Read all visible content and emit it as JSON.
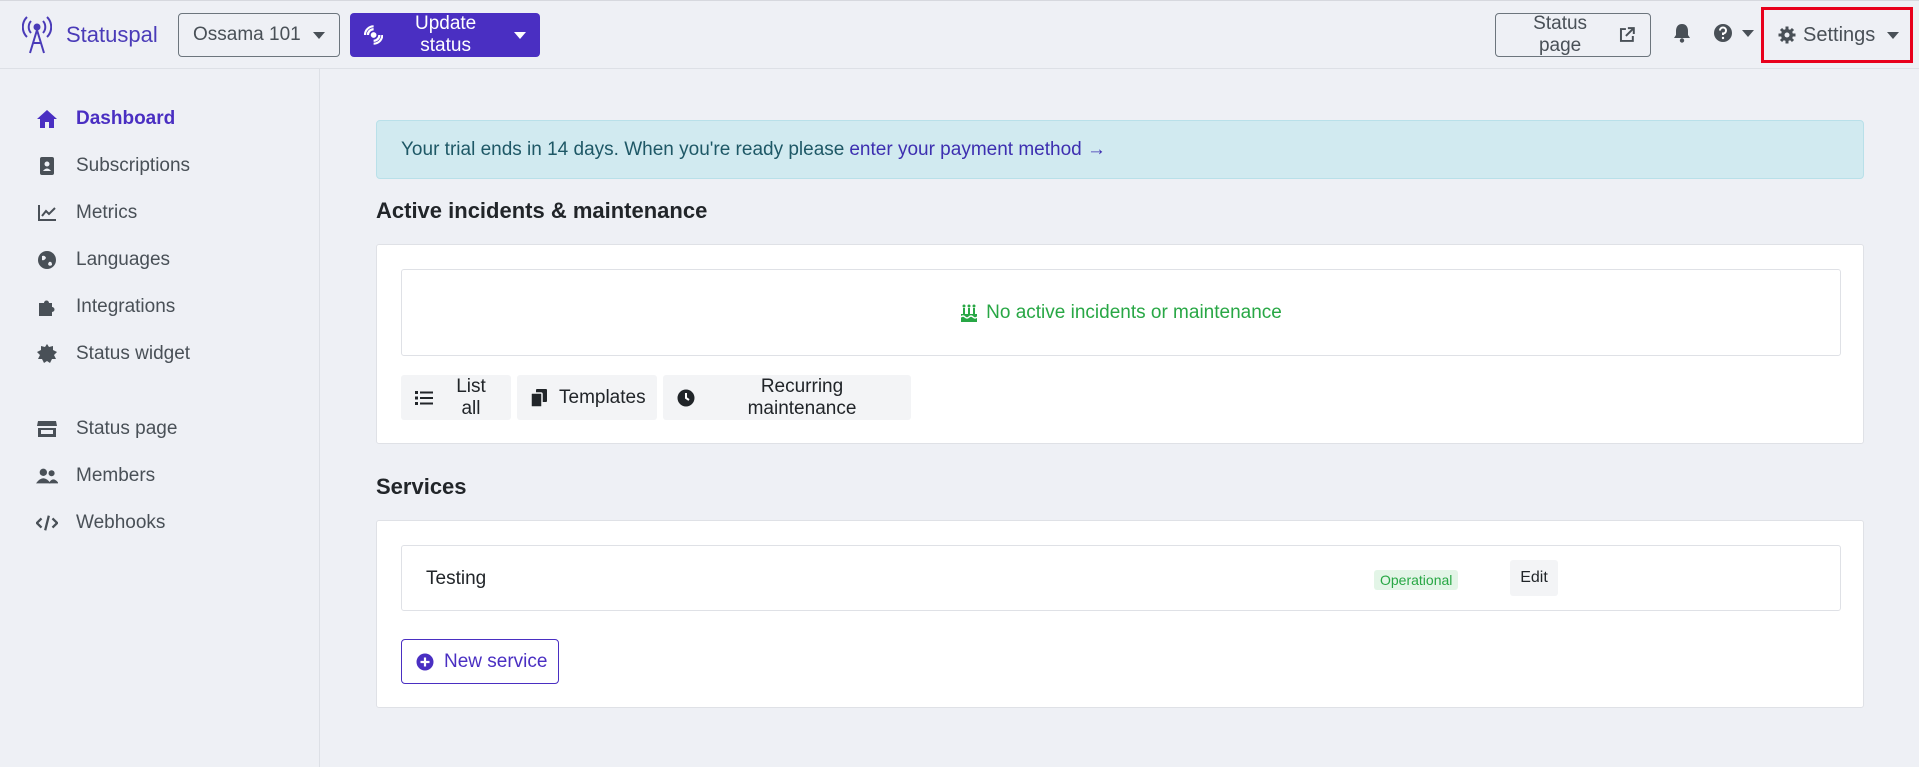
{
  "brand": {
    "name": "Statuspal"
  },
  "header": {
    "org_selector": "Ossama 101",
    "update_status": "Update status",
    "status_page": "Status page",
    "settings": "Settings"
  },
  "sidebar": {
    "items": [
      {
        "label": "Dashboard",
        "icon": "home-icon",
        "active": true
      },
      {
        "label": "Subscriptions",
        "icon": "address-book-icon"
      },
      {
        "label": "Metrics",
        "icon": "chart-line-icon"
      },
      {
        "label": "Languages",
        "icon": "globe-icon"
      },
      {
        "label": "Integrations",
        "icon": "puzzle-icon"
      },
      {
        "label": "Status widget",
        "icon": "certificate-icon"
      },
      {
        "label": "Status page",
        "icon": "store-icon"
      },
      {
        "label": "Members",
        "icon": "users-icon"
      },
      {
        "label": "Webhooks",
        "icon": "code-icon"
      }
    ]
  },
  "alert": {
    "text": "Your trial ends in 14 days. When you're ready please",
    "link": "enter your payment method →"
  },
  "incidents": {
    "title": "Active incidents & maintenance",
    "empty_message": "No active incidents or maintenance",
    "buttons": {
      "list_all": "List all",
      "templates": "Templates",
      "recurring": "Recurring maintenance"
    }
  },
  "services": {
    "title": "Services",
    "rows": [
      {
        "name": "Testing",
        "status": "Operational",
        "edit": "Edit"
      }
    ],
    "new_service": "New service"
  },
  "colors": {
    "brand": "#4a2fc2",
    "success": "#28a745",
    "highlight_border": "#e8001c"
  }
}
